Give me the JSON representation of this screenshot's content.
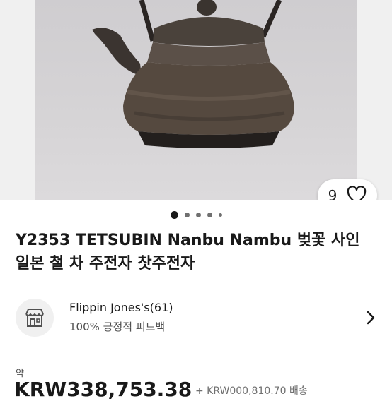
{
  "gallery": {
    "image_alt": "cast iron tetsubin kettle",
    "like_count": "9",
    "dot_count": 5,
    "active_dot": 0
  },
  "listing": {
    "title_line1": "Y2353 TETSUBIN Nanbu Nambu 벚꽃 사인",
    "title_line2": "일본 철 차 주전자 찻주전자"
  },
  "seller": {
    "name": "Flippin Jones's(61)",
    "feedback": "100% 긍정적 피드백"
  },
  "price": {
    "approx_label": "약",
    "amount": "KRW338,753.38",
    "shipping_partial": "+ KRW000,810.70 배송"
  },
  "colors": {
    "text": "#191919",
    "muted": "#505050",
    "background": "#ffffff"
  },
  "icons": [
    "heart-icon",
    "store-icon",
    "chevron-right-icon"
  ]
}
